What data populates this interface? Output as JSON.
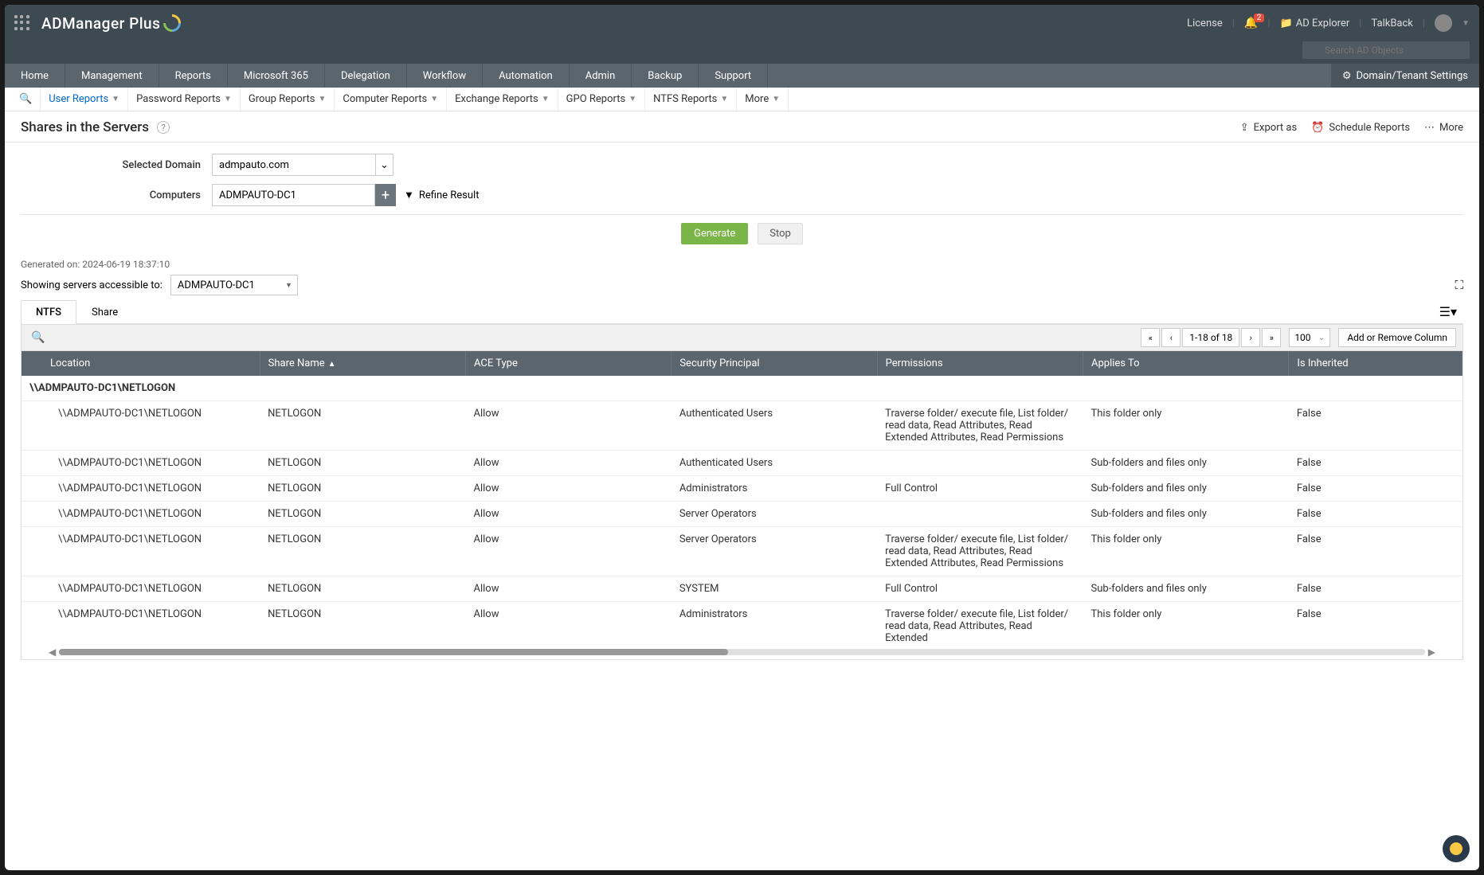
{
  "header": {
    "brand": "ADManager Plus",
    "license": "License",
    "notif_count": "2",
    "ad_explorer": "AD Explorer",
    "talkback": "TalkBack",
    "search_placeholder": "Search AD Objects"
  },
  "main_nav": [
    "Home",
    "Management",
    "Reports",
    "Microsoft 365",
    "Delegation",
    "Workflow",
    "Automation",
    "Admin",
    "Backup",
    "Support"
  ],
  "domain_settings": "Domain/Tenant Settings",
  "sub_nav": [
    "User Reports",
    "Password Reports",
    "Group Reports",
    "Computer Reports",
    "Exchange Reports",
    "GPO Reports",
    "NTFS Reports",
    "More"
  ],
  "page": {
    "title": "Shares in the Servers",
    "export_as": "Export as",
    "schedule": "Schedule Reports",
    "more": "More"
  },
  "form": {
    "selected_domain_label": "Selected Domain",
    "selected_domain_value": "admpauto.com",
    "computers_label": "Computers",
    "computers_value": "ADMPAUTO-DC1",
    "refine": "Refine Result",
    "generate": "Generate",
    "stop": "Stop"
  },
  "results": {
    "generated_on": "Generated on: 2024-06-19 18:37:10",
    "showing_label": "Showing servers accessible to:",
    "showing_value": "ADMPAUTO-DC1",
    "tabs": {
      "ntfs": "NTFS",
      "share": "Share"
    },
    "page_label": "1-18 of 18",
    "page_size": "100",
    "add_col": "Add or Remove Column"
  },
  "columns": [
    "Location",
    "Share Name",
    "ACE Type",
    "Security Principal",
    "Permissions",
    "Applies To",
    "Is Inherited"
  ],
  "group_header": "\\\\ADMPAUTO-DC1\\NETLOGON",
  "rows": [
    {
      "loc": "\\\\ADMPAUTO-DC1\\NETLOGON",
      "share": "NETLOGON",
      "ace": "Allow",
      "sp": "Authenticated Users",
      "perm": "Traverse folder/ execute file, List folder/ read data, Read Attributes, Read Extended Attributes, Read Permissions",
      "app": "This folder only",
      "inh": "False"
    },
    {
      "loc": "\\\\ADMPAUTO-DC1\\NETLOGON",
      "share": "NETLOGON",
      "ace": "Allow",
      "sp": "Authenticated Users",
      "perm": "",
      "app": "Sub-folders and files only",
      "inh": "False"
    },
    {
      "loc": "\\\\ADMPAUTO-DC1\\NETLOGON",
      "share": "NETLOGON",
      "ace": "Allow",
      "sp": "Administrators",
      "perm": "Full Control",
      "app": "Sub-folders and files only",
      "inh": "False"
    },
    {
      "loc": "\\\\ADMPAUTO-DC1\\NETLOGON",
      "share": "NETLOGON",
      "ace": "Allow",
      "sp": "Server Operators",
      "perm": "",
      "app": "Sub-folders and files only",
      "inh": "False"
    },
    {
      "loc": "\\\\ADMPAUTO-DC1\\NETLOGON",
      "share": "NETLOGON",
      "ace": "Allow",
      "sp": "Server Operators",
      "perm": "Traverse folder/ execute file, List folder/ read data, Read Attributes, Read Extended Attributes, Read Permissions",
      "app": "This folder only",
      "inh": "False"
    },
    {
      "loc": "\\\\ADMPAUTO-DC1\\NETLOGON",
      "share": "NETLOGON",
      "ace": "Allow",
      "sp": "SYSTEM",
      "perm": "Full Control",
      "app": "Sub-folders and files only",
      "inh": "False"
    },
    {
      "loc": "\\\\ADMPAUTO-DC1\\NETLOGON",
      "share": "NETLOGON",
      "ace": "Allow",
      "sp": "Administrators",
      "perm": "Traverse folder/ execute file, List folder/ read data, Read Attributes, Read Extended",
      "app": "This folder only",
      "inh": "False"
    }
  ]
}
